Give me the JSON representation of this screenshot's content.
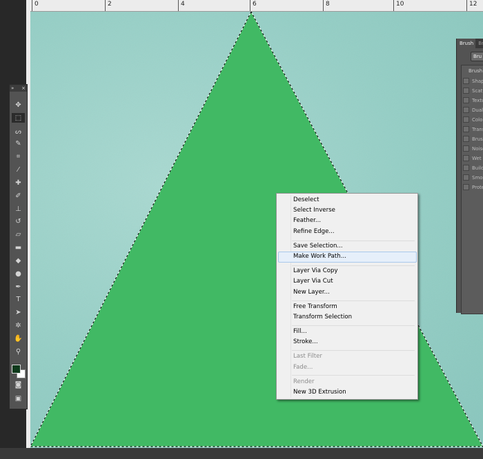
{
  "ruler": {
    "labels": [
      "0",
      "2",
      "4",
      "6",
      "8",
      "10",
      "12"
    ]
  },
  "tools_panel": {
    "collapse_label": "»",
    "close_label": "×",
    "tools": [
      {
        "name": "move-tool-icon",
        "glyph": "✥"
      },
      {
        "name": "rect-marquee-tool-icon",
        "glyph": "⬚"
      },
      {
        "name": "lasso-tool-icon",
        "glyph": "ᔕ"
      },
      {
        "name": "quick-select-tool-icon",
        "glyph": "✎"
      },
      {
        "name": "crop-tool-icon",
        "glyph": "⌗"
      },
      {
        "name": "eyedropper-tool-icon",
        "glyph": "⁄"
      },
      {
        "name": "healing-brush-tool-icon",
        "glyph": "✚"
      },
      {
        "name": "brush-tool-icon",
        "glyph": "✐"
      },
      {
        "name": "clone-stamp-tool-icon",
        "glyph": "⊥"
      },
      {
        "name": "history-brush-tool-icon",
        "glyph": "↺"
      },
      {
        "name": "eraser-tool-icon",
        "glyph": "▱"
      },
      {
        "name": "gradient-tool-icon",
        "glyph": "▬"
      },
      {
        "name": "blur-tool-icon",
        "glyph": "◆"
      },
      {
        "name": "dodge-tool-icon",
        "glyph": "●"
      },
      {
        "name": "pen-tool-icon",
        "glyph": "✒"
      },
      {
        "name": "type-tool-icon",
        "glyph": "T"
      },
      {
        "name": "path-select-tool-icon",
        "glyph": "➤"
      },
      {
        "name": "custom-shape-tool-icon",
        "glyph": "✲"
      },
      {
        "name": "hand-tool-icon",
        "glyph": "✋"
      },
      {
        "name": "zoom-tool-icon",
        "glyph": "⚲"
      }
    ],
    "foreground_color": "#0f3a1c",
    "background_color": "#ffffff"
  },
  "brush_panel": {
    "tabs": [
      "Brush",
      "Br"
    ],
    "button_label": "Bru",
    "list_header": "Brush",
    "items": [
      "Shap",
      "Scatt",
      "Textu",
      "Dual",
      "Color",
      "Trans",
      "Brush",
      "Noise",
      "Wet E",
      "Build",
      "Smoo",
      "Prote"
    ]
  },
  "context_menu": {
    "items": [
      {
        "label": "Deselect",
        "enabled": true
      },
      {
        "label": "Select Inverse",
        "enabled": true
      },
      {
        "label": "Feather...",
        "enabled": true
      },
      {
        "label": "Refine Edge...",
        "enabled": true
      },
      {
        "label": "Save Selection...",
        "enabled": true
      },
      {
        "label": "Make Work Path...",
        "enabled": true,
        "highlighted": true
      },
      {
        "label": "Layer Via Copy",
        "enabled": true
      },
      {
        "label": "Layer Via Cut",
        "enabled": true
      },
      {
        "label": "New Layer...",
        "enabled": true
      },
      {
        "label": "Free Transform",
        "enabled": true
      },
      {
        "label": "Transform Selection",
        "enabled": true
      },
      {
        "label": "Fill...",
        "enabled": true
      },
      {
        "label": "Stroke...",
        "enabled": true
      },
      {
        "label": "Last Filter",
        "enabled": false
      },
      {
        "label": "Fade...",
        "enabled": false
      },
      {
        "label": "Render",
        "enabled": false
      },
      {
        "label": "New 3D Extrusion",
        "enabled": true
      }
    ]
  },
  "canvas": {
    "background_color": "#94cec5",
    "triangle_color": "#41b964"
  }
}
